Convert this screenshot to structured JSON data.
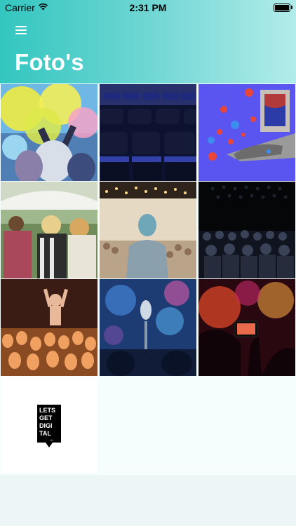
{
  "status_bar": {
    "carrier": "Carrier",
    "time": "2:31 PM"
  },
  "header": {
    "title": "Foto's"
  },
  "logo": {
    "lines": [
      "LETS",
      "GET",
      "DIGI",
      "TAL"
    ],
    "dots": "..."
  },
  "photos": [
    {
      "subject": "holi-color-festival"
    },
    {
      "subject": "empty-theatre-seats"
    },
    {
      "subject": "live-stream-reactions"
    },
    {
      "subject": "festival-crowd"
    },
    {
      "subject": "speaker-at-event"
    },
    {
      "subject": "conference-audience"
    },
    {
      "subject": "concert-crowd-hands"
    },
    {
      "subject": "stage-microphone"
    },
    {
      "subject": "concert-phone-recording"
    },
    {
      "subject": "lets-get-digital-logo"
    }
  ]
}
